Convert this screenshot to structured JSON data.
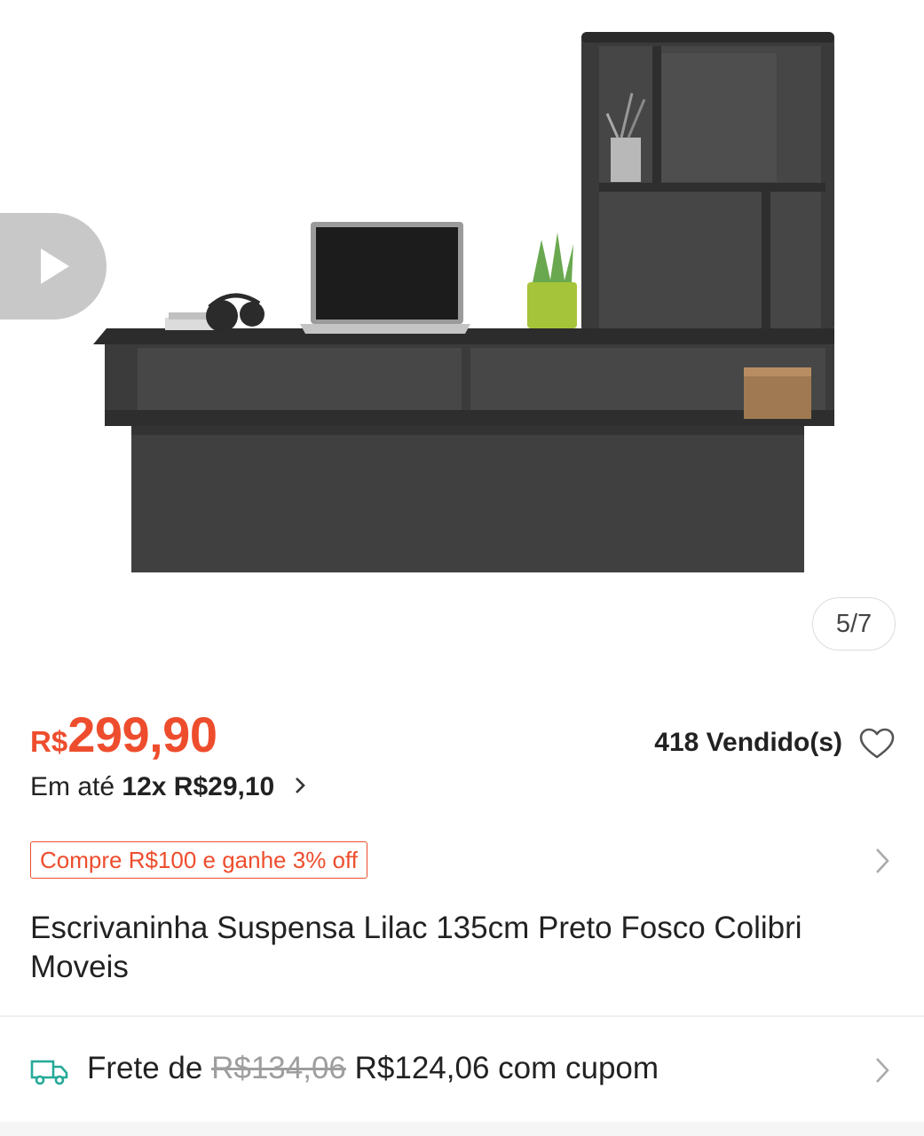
{
  "gallery": {
    "counter": "5/7",
    "play_icon": "play-icon",
    "product_image_alt": "Escrivaninha Suspensa Lilac 135cm Preto Fosco"
  },
  "price": {
    "currency": "R$",
    "amount": "299,90",
    "color": "#ee4d2d"
  },
  "sold": {
    "label": "418 Vendido(s)",
    "icon": "heart-outline-icon"
  },
  "installment": {
    "prefix": "Em até",
    "value": "12x R$29,10",
    "icon": "chevron-right-icon"
  },
  "promo": {
    "label": "Compre R$100 e ganhe 3% off",
    "icon": "chevron-right-icon"
  },
  "product": {
    "title": "Escrivaninha Suspensa Lilac 135cm Preto Fosco Colibri Moveis"
  },
  "shipping": {
    "prefix": "Frete de",
    "old_price": "R$134,06",
    "new_price": "R$124,06 com cupom",
    "icon": "truck-icon",
    "accent": "#26aa99"
  }
}
